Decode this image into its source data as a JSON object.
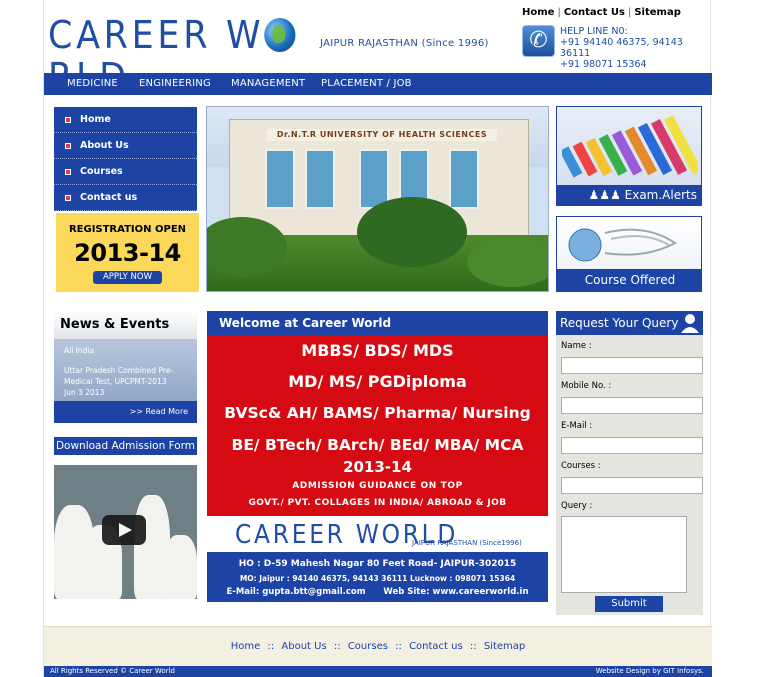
{
  "header": {
    "logo_text": "CAREER WORLD",
    "tagline": "JAIPUR RAJASTHAN (Since 1996)",
    "top_links": [
      "Home",
      "Contact Us",
      "Sitemap"
    ],
    "helpline_label": "HELP LINE N0:",
    "helpline_1": "+91 94140 46375, 94143 36111",
    "helpline_2": "+91 98071 15364"
  },
  "nav": [
    "MEDICINE",
    "ENGINEERING",
    "MANAGEMENT",
    "PLACEMENT / JOB"
  ],
  "left_menu": [
    "Home",
    "About Us",
    "Courses",
    "Contact us"
  ],
  "registration": {
    "line1": "REGISTRATION OPEN",
    "line2": "2013-14",
    "button": "APPLY NOW"
  },
  "hero": {
    "sign_text": "Dr.N.T.R UNIVERSITY OF HEALTH SCIENCES"
  },
  "exam": {
    "label": "Exam.Alerts"
  },
  "course": {
    "label": "Course Offered"
  },
  "news": {
    "title": "News & Events",
    "item1": "All India",
    "item2": "Uttar Pradesh Combined Pre-Medical Test, UPCPMT-2013",
    "item3": "Jun 3 2013",
    "more": ">> Read More"
  },
  "download": "Download Admission Form",
  "welcome": {
    "title": "Welcome at Career World",
    "lines": [
      "MBBS/ BDS/ MDS",
      "MD/ MS/ PGDiploma",
      "BVSc& AH/ BAMS/ Pharma/ Nursing",
      "BE/ BTech/ BArch/ BEd/ MBA/ MCA",
      "2013-14",
      "ADMISSION GUIDANCE ON TOP",
      "GOVT./ PVT. COLLAGES IN INDIA/ ABROAD & JOB"
    ],
    "promo_logo": "CAREER WORLD",
    "promo_tag": "JAIPUR RAJASTHAN (Since1996)",
    "contact_1": "HO : D-59 Mahesh Nagar 80 Feet Road- JAIPUR-302015",
    "contact_2": "MO: Jaipur : 94140 46375, 94143 36111 Lucknow : 098071 15364",
    "contact_3": "E-Mail: gupta.btt@gmail.com      Web Site: www.careerworld.in"
  },
  "query": {
    "title": "Request Your Query",
    "fields": [
      "Name :",
      "Mobile No. :",
      "E-Mail :",
      "Courses :",
      "Query :"
    ],
    "submit": "Submit"
  },
  "footer": {
    "links": [
      "Home",
      "About Us",
      "Courses",
      "Contact us",
      "Sitemap"
    ],
    "separator": "::",
    "copyright": "All Rights Reserved © Career World",
    "credit": "Website Design by GIT Infosys."
  },
  "colors": {
    "brand_blue": "#1d43a4",
    "promo_red": "#d60a12",
    "reg_yellow": "#fbd75a"
  }
}
